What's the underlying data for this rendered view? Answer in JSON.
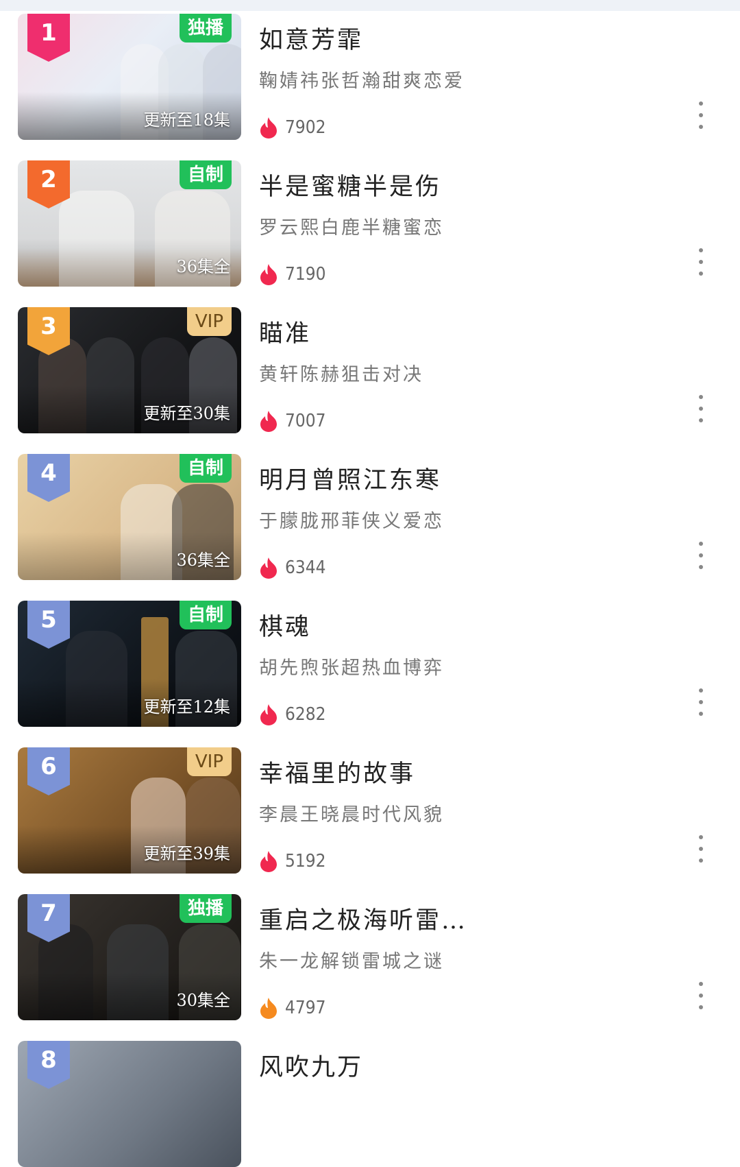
{
  "items": [
    {
      "rank": "1",
      "title": "如意芳霏",
      "desc": "鞠婧祎张哲瀚甜爽恋爱",
      "tag": "独播",
      "tag_style": "green",
      "episodes": "更新至18集",
      "heat": "7902",
      "flame_color": "#f0284f",
      "rank_color": "#ef2e6e"
    },
    {
      "rank": "2",
      "title": "半是蜜糖半是伤",
      "desc": "罗云熙白鹿半糖蜜恋",
      "tag": "自制",
      "tag_style": "green",
      "episodes": "36集全",
      "heat": "7190",
      "flame_color": "#f0284f",
      "rank_color": "#f36a2d"
    },
    {
      "rank": "3",
      "title": "瞄准",
      "desc": "黄轩陈赫狙击对决",
      "tag": "VIP",
      "tag_style": "vip",
      "episodes": "更新至30集",
      "heat": "7007",
      "flame_color": "#f0284f",
      "rank_color": "#f2a43a"
    },
    {
      "rank": "4",
      "title": "明月曾照江东寒",
      "desc": "于朦胧邢菲侠义爱恋",
      "tag": "自制",
      "tag_style": "green",
      "episodes": "36集全",
      "heat": "6344",
      "flame_color": "#f0284f",
      "rank_color": "#7c93d6"
    },
    {
      "rank": "5",
      "title": "棋魂",
      "desc": "胡先煦张超热血博弈",
      "tag": "自制",
      "tag_style": "green",
      "episodes": "更新至12集",
      "heat": "6282",
      "flame_color": "#f0284f",
      "rank_color": "#7c93d6"
    },
    {
      "rank": "6",
      "title": "幸福里的故事",
      "desc": "李晨王晓晨时代风貌",
      "tag": "VIP",
      "tag_style": "vip",
      "episodes": "更新至39集",
      "heat": "5192",
      "flame_color": "#f0284f",
      "rank_color": "#7c93d6"
    },
    {
      "rank": "7",
      "title": "重启之极海听雷…",
      "desc": "朱一龙解锁雷城之谜",
      "tag": "独播",
      "tag_style": "green",
      "episodes": "30集全",
      "heat": "4797",
      "flame_color": "#f58a1f",
      "rank_color": "#7c93d6"
    },
    {
      "rank": "8",
      "title": "风吹九万",
      "desc": "",
      "tag": "",
      "tag_style": "none",
      "episodes": "",
      "heat": "",
      "flame_color": "#f58a1f",
      "rank_color": "#7c93d6"
    }
  ],
  "icons": {
    "heat": "flame-icon",
    "more": "more-vertical-icon"
  }
}
